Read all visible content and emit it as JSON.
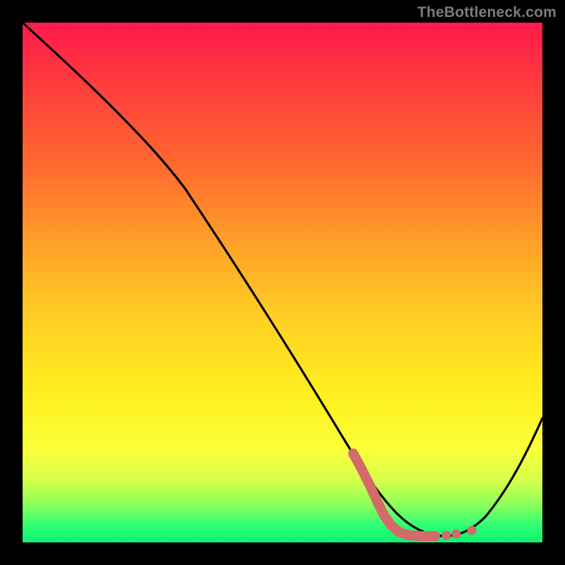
{
  "watermark": "TheBottleneck.com",
  "colors": {
    "frame": "#000000",
    "watermark": "#7b7b7b",
    "curve": "#000000",
    "marker": "#d46a6a"
  },
  "chart_data": {
    "type": "line",
    "title": "",
    "xlabel": "",
    "ylabel": "",
    "xlim": [
      0,
      100
    ],
    "ylim": [
      0,
      100
    ],
    "grid": false,
    "legend": false,
    "x": [
      0,
      8,
      16,
      24,
      32,
      40,
      48,
      56,
      64,
      70,
      74,
      78,
      82,
      86,
      90,
      94,
      98,
      100
    ],
    "values": [
      100,
      92,
      84,
      76,
      66,
      56,
      45,
      34,
      23,
      13,
      7,
      3,
      1,
      1,
      3,
      8,
      18,
      25
    ],
    "marker_region": {
      "x_start": 63,
      "x_end": 82,
      "style": "thick-dotted"
    }
  }
}
